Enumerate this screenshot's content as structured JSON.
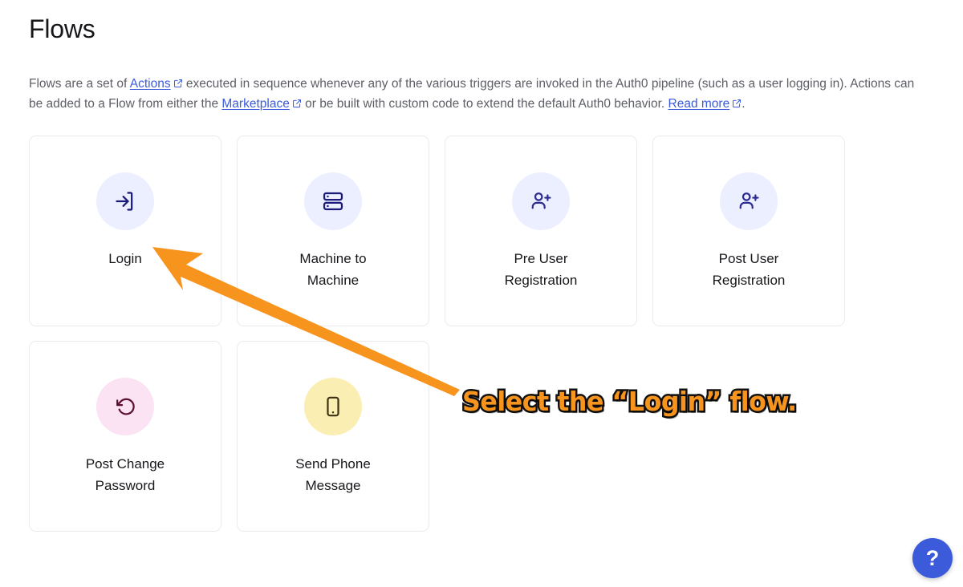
{
  "header": {
    "title": "Flows",
    "description_parts": [
      {
        "type": "text",
        "value": "Flows are a set of "
      },
      {
        "type": "link",
        "value": "Actions",
        "external": true
      },
      {
        "type": "text",
        "value": " executed in sequence whenever any of the various triggers are invoked in the Auth0 pipeline (such as a user logging in). Actions can be added to a Flow from either the "
      },
      {
        "type": "link",
        "value": "Marketplace",
        "external": true
      },
      {
        "type": "text",
        "value": " or be built with custom code to extend the default Auth0 behavior. "
      },
      {
        "type": "link",
        "value": "Read more",
        "external": true
      },
      {
        "type": "text",
        "value": "."
      }
    ],
    "line1_pre": "Flows are a set of ",
    "link_actions": "Actions",
    "line1_mid": " executed in sequence whenever any of the various triggers are invoked in the Auth0 pipeline (such as a user logging in). Actions can be added to a Flow from either the ",
    "link_marketplace": "Marketplace",
    "line2_mid": " or be built with custom code to extend the default Auth0 behavior. ",
    "link_readmore": "Read more",
    "line2_end": "."
  },
  "flows": [
    {
      "label": "Login",
      "icon": "login-arrow-icon",
      "bubble_color": "#ecefff",
      "icon_color": "#1a1a7a"
    },
    {
      "label": "Machine to\nMachine",
      "icon": "server-stack-icon",
      "bubble_color": "#ecefff",
      "icon_color": "#1a1a7a"
    },
    {
      "label": "Pre User\nRegistration",
      "icon": "user-plus-icon",
      "bubble_color": "#ecefff",
      "icon_color": "#2b2b8f"
    },
    {
      "label": "Post User\nRegistration",
      "icon": "user-plus-icon",
      "bubble_color": "#ecefff",
      "icon_color": "#2b2b8f"
    },
    {
      "label": "Post Change\nPassword",
      "icon": "rotate-ccw-icon",
      "bubble_color": "#fbe3f3",
      "icon_color": "#5c1030"
    },
    {
      "label": "Send Phone\nMessage",
      "icon": "smartphone-icon",
      "bubble_color": "#fbeeb3",
      "icon_color": "#3d3212"
    }
  ],
  "annotation": {
    "text": "Select the “Login” flow.",
    "arrow_color": "#F7941E",
    "text_fill_color": "#F7941E",
    "text_outline_color": "#111111"
  },
  "help": {
    "label": "?",
    "color": "#3b5bdb"
  }
}
